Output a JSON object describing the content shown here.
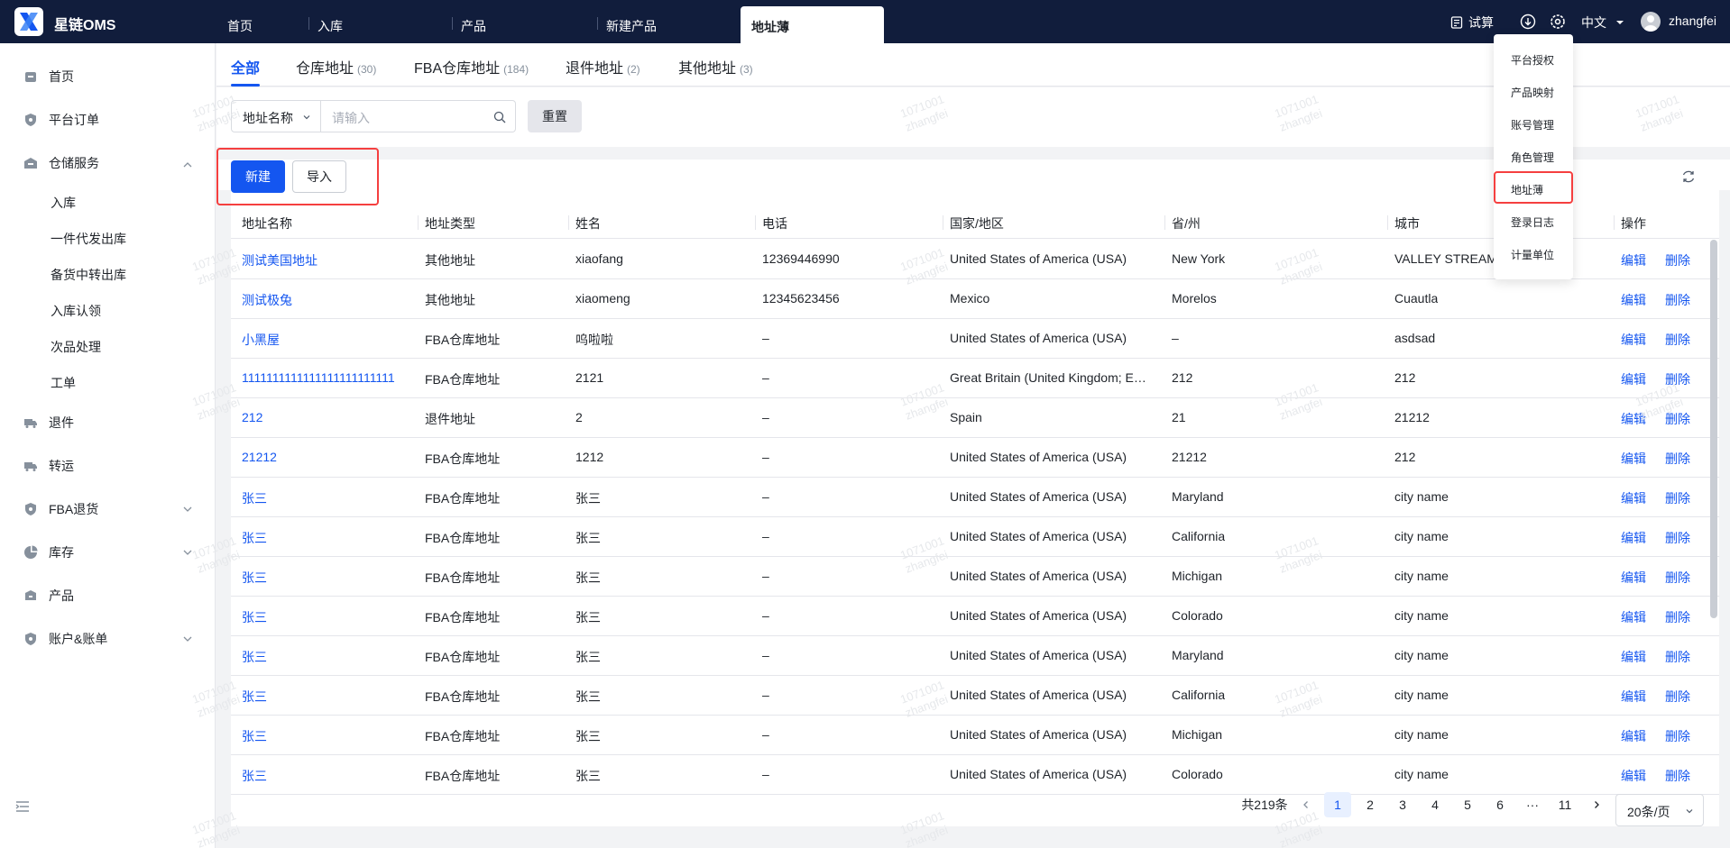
{
  "app": {
    "brand": "星链OMS"
  },
  "topnav": {
    "tabs": [
      "首页",
      "入库",
      "产品",
      "新建产品",
      "地址薄"
    ],
    "trial": "试算",
    "language": "中文",
    "user": "zhangfei"
  },
  "settings_menu": {
    "items": [
      "平台授权",
      "产品映射",
      "账号管理",
      "角色管理",
      "地址薄",
      "登录日志",
      "计量单位"
    ],
    "highlighted": "地址薄"
  },
  "sidebar": {
    "items": [
      {
        "label": "首页",
        "icon": "home-icon"
      },
      {
        "label": "平台订单",
        "icon": "shield-icon"
      },
      {
        "label": "仓储服务",
        "icon": "warehouse-icon",
        "expanded": true
      },
      {
        "label": "退件",
        "icon": "return-truck-icon"
      },
      {
        "label": "转运",
        "icon": "transfer-truck-icon"
      },
      {
        "label": "FBA退货",
        "icon": "shield-icon"
      },
      {
        "label": "库存",
        "icon": "pie-chart-icon"
      },
      {
        "label": "产品",
        "icon": "box-icon"
      },
      {
        "label": "账户&账单",
        "icon": "shield-icon"
      }
    ],
    "sub_items": [
      "入库",
      "一件代发出库",
      "备货中转出库",
      "入库认领",
      "次品处理",
      "工单"
    ]
  },
  "tabs": [
    {
      "label": "全部",
      "count": ""
    },
    {
      "label": "仓库地址",
      "count": "(30)"
    },
    {
      "label": "FBA仓库地址",
      "count": "(184)"
    },
    {
      "label": "退件地址",
      "count": "(2)"
    },
    {
      "label": "其他地址",
      "count": "(3)"
    }
  ],
  "filter": {
    "field": "地址名称",
    "placeholder": "请输入",
    "reset": "重置"
  },
  "actions": {
    "new": "新建",
    "import": "导入"
  },
  "table": {
    "columns": [
      "地址名称",
      "地址类型",
      "姓名",
      "电话",
      "国家/地区",
      "省/州",
      "城市",
      "操作"
    ],
    "edit_label": "编辑",
    "delete_label": "删除",
    "rows": [
      [
        "测试美国地址",
        "其他地址",
        "xiaofang",
        "12369446990",
        "United States of America (USA)",
        "New York",
        "VALLEY STREAM"
      ],
      [
        "测试极兔",
        "其他地址",
        "xiaomeng",
        "12345623456",
        "Mexico",
        "Morelos",
        "Cuautla"
      ],
      [
        "小黑屋",
        "FBA仓库地址",
        "呜啦啦",
        "–",
        "United States of America (USA)",
        "–",
        "asdsad"
      ],
      [
        "1111111111111111111111111",
        "FBA仓库地址",
        "2121",
        "–",
        "Great Britain (United Kingdom; E…",
        "212",
        "212"
      ],
      [
        "212",
        "退件地址",
        "2",
        "–",
        "Spain",
        "21",
        "21212"
      ],
      [
        "21212",
        "FBA仓库地址",
        "1212",
        "–",
        "United States of America (USA)",
        "21212",
        "212"
      ],
      [
        "张三",
        "FBA仓库地址",
        "张三",
        "–",
        "United States of America (USA)",
        "Maryland",
        "city name"
      ],
      [
        "张三",
        "FBA仓库地址",
        "张三",
        "–",
        "United States of America (USA)",
        "California",
        "city name"
      ],
      [
        "张三",
        "FBA仓库地址",
        "张三",
        "–",
        "United States of America (USA)",
        "Michigan",
        "city name"
      ],
      [
        "张三",
        "FBA仓库地址",
        "张三",
        "–",
        "United States of America (USA)",
        "Colorado",
        "city name"
      ],
      [
        "张三",
        "FBA仓库地址",
        "张三",
        "–",
        "United States of America (USA)",
        "Maryland",
        "city name"
      ],
      [
        "张三",
        "FBA仓库地址",
        "张三",
        "–",
        "United States of America (USA)",
        "California",
        "city name"
      ],
      [
        "张三",
        "FBA仓库地址",
        "张三",
        "–",
        "United States of America (USA)",
        "Michigan",
        "city name"
      ],
      [
        "张三",
        "FBA仓库地址",
        "张三",
        "–",
        "United States of America (USA)",
        "Colorado",
        "city name"
      ]
    ]
  },
  "pagination": {
    "total": "共219条",
    "pages": [
      "1",
      "2",
      "3",
      "4",
      "5",
      "6",
      "···",
      "11"
    ],
    "current": "1",
    "page_size": "20条/页"
  },
  "watermark": {
    "line1": "1071001",
    "line2": "zhangfei"
  },
  "colors": {
    "primary": "#1456f0",
    "topbar": "#111d3c",
    "highlight": "#f53f3f"
  }
}
